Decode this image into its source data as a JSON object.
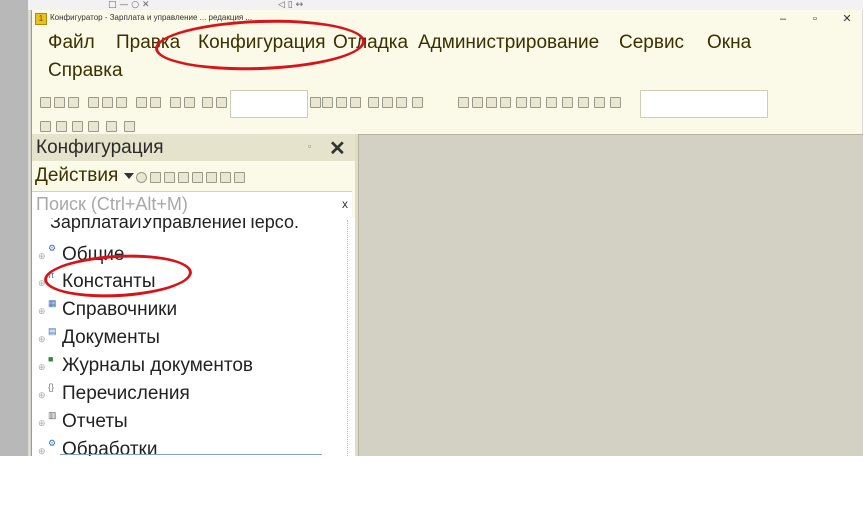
{
  "window": {
    "title": "Конфигуратор - Зарплата и управление ... редакция ...",
    "minimize": "–",
    "maximize": "▫",
    "close": "✕"
  },
  "top_strip": {
    "left_glyphs": "□ — ○ ✕",
    "right_glyphs": "◁  ▯  ↔"
  },
  "menu": [
    "Файл",
    "Правка",
    "Конфигурация",
    "Отладка",
    "Администрирование",
    "Сервис",
    "Окна",
    "Справка"
  ],
  "toolbar": {
    "combo1_value": "",
    "combo2_value": ""
  },
  "config_panel": {
    "title": "Конфигурация",
    "pin": "▫",
    "close": "✕",
    "actions_label": "Действия",
    "search_placeholder": "Поиск (Ctrl+Alt+M)",
    "search_clear": "x",
    "root": "ЗарплатаИУправлениеПерсо.",
    "items": [
      {
        "label": "Общие",
        "icon": "folder-gears-icon"
      },
      {
        "label": "Константы",
        "icon": "constant-icon"
      },
      {
        "label": "Справочники",
        "icon": "catalog-icon"
      },
      {
        "label": "Документы",
        "icon": "document-icon"
      },
      {
        "label": "Журналы документов",
        "icon": "journal-icon"
      },
      {
        "label": "Перечисления",
        "icon": "enum-icon"
      },
      {
        "label": "Отчеты",
        "icon": "report-icon"
      },
      {
        "label": "Обработки",
        "icon": "processing-icon"
      }
    ]
  },
  "annotation_color": "#d8141b"
}
